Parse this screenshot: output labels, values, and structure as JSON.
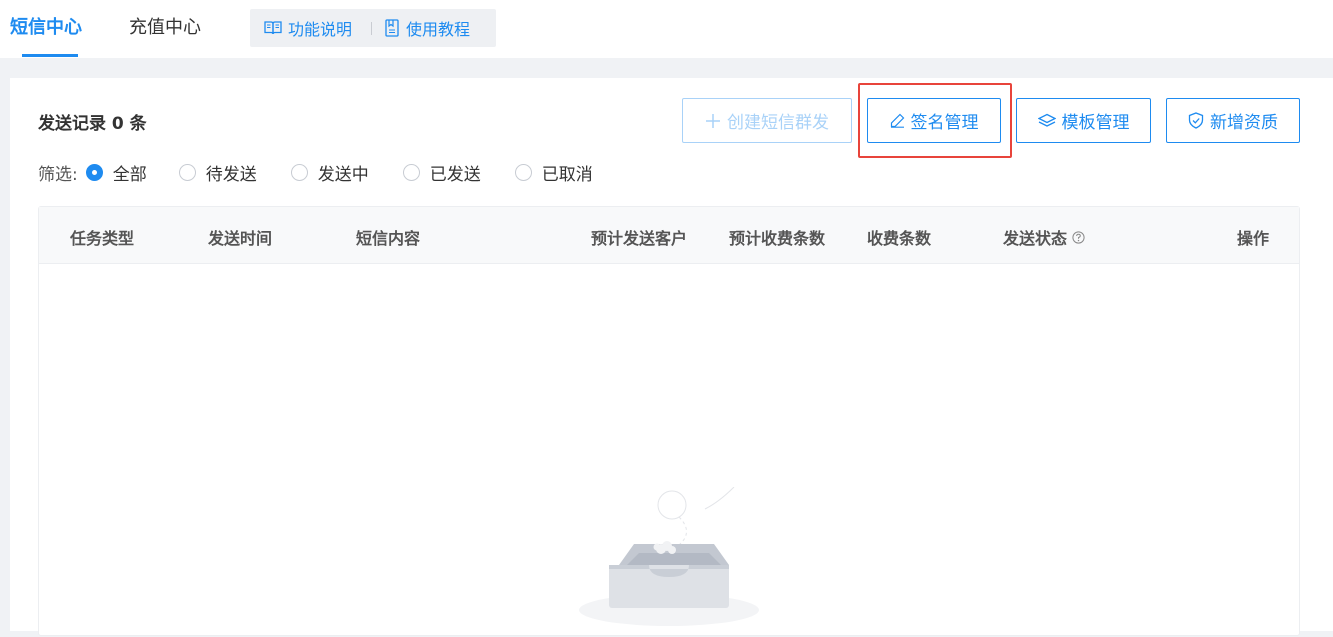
{
  "header": {
    "tabs": [
      {
        "label": "短信中心",
        "active": true
      },
      {
        "label": "充值中心",
        "active": false
      }
    ],
    "help_links": [
      {
        "label": "功能说明",
        "icon": "book-open-icon"
      },
      {
        "label": "使用教程",
        "icon": "document-icon"
      }
    ]
  },
  "main": {
    "record_title": "发送记录 0 条",
    "buttons": {
      "create": "创建短信群发",
      "signature": "签名管理",
      "template": "模板管理",
      "qualification": "新增资质"
    },
    "filter": {
      "label": "筛选:",
      "options": [
        "全部",
        "待发送",
        "发送中",
        "已发送",
        "已取消"
      ],
      "selected": "全部"
    },
    "table": {
      "columns": [
        "任务类型",
        "发送时间",
        "短信内容",
        "预计发送客户",
        "预计收费条数",
        "收费条数",
        "发送状态",
        "操作"
      ],
      "rows": []
    }
  },
  "colors": {
    "accent": "#1e8bf0",
    "highlight": "#e8443b",
    "disabled": "#a9d2f8"
  }
}
